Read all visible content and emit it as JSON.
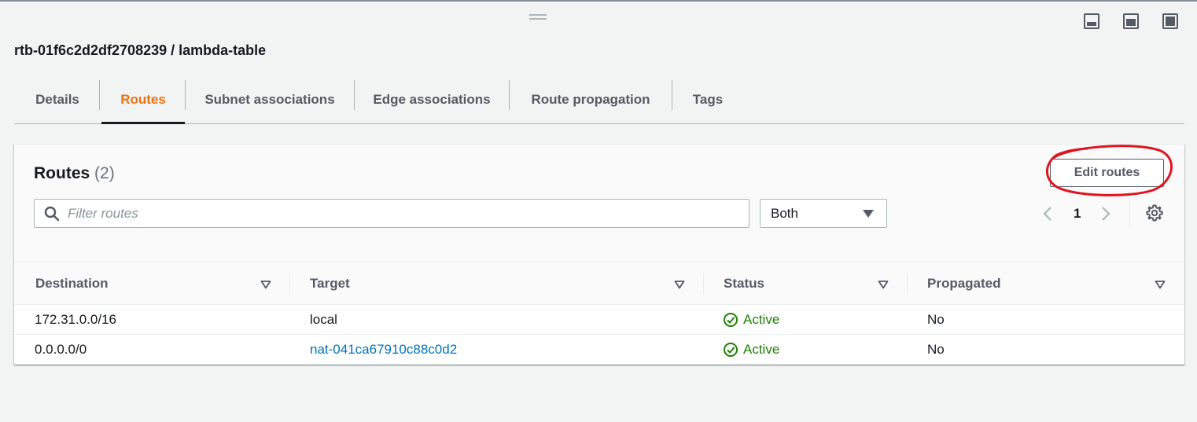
{
  "panel": {
    "title": "rtb-01f6c2d2df2708239 / lambda-table",
    "layout_icons": [
      "panel-bottom-icon",
      "panel-side-icon",
      "panel-full-icon"
    ]
  },
  "tabs": [
    {
      "label": "Details",
      "active": false
    },
    {
      "label": "Routes",
      "active": true
    },
    {
      "label": "Subnet associations",
      "active": false
    },
    {
      "label": "Edge associations",
      "active": false
    },
    {
      "label": "Route propagation",
      "active": false
    },
    {
      "label": "Tags",
      "active": false
    }
  ],
  "routes": {
    "title": "Routes",
    "count": "(2)",
    "edit_button": "Edit routes",
    "filter_placeholder": "Filter routes",
    "select_value": "Both",
    "page": "1",
    "columns": [
      "Destination",
      "Target",
      "Status",
      "Propagated"
    ],
    "rows": [
      {
        "destination": "172.31.0.0/16",
        "target": "local",
        "target_link": false,
        "status": "Active",
        "propagated": "No"
      },
      {
        "destination": "0.0.0.0/0",
        "target": "nat-041ca67910c88c0d2",
        "target_link": true,
        "status": "Active",
        "propagated": "No"
      }
    ]
  },
  "colors": {
    "accent": "#ec7211",
    "link": "#0073bb",
    "success": "#1d8102",
    "annotation": "#e0141e"
  }
}
